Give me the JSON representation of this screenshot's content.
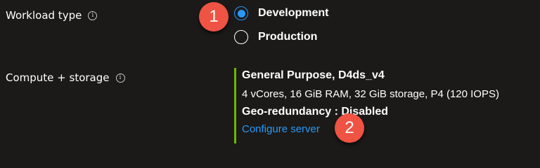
{
  "workload": {
    "label": "Workload type",
    "info_icon": "info-icon",
    "options": [
      {
        "label": "Development",
        "selected": true
      },
      {
        "label": "Production",
        "selected": false
      }
    ]
  },
  "compute": {
    "label": "Compute + storage",
    "info_icon": "info-icon",
    "summary_title": "General Purpose, D4ds_v4",
    "summary_specs": "4 vCores, 16 GiB RAM, 32 GiB storage, P4 (120 IOPS)",
    "geo_redundancy": "Geo-redundancy : Disabled",
    "configure_link": "Configure server"
  },
  "annotations": {
    "step1": "1",
    "step2": "2"
  },
  "colors": {
    "background": "#1b1a19",
    "accent_blue": "#2899f5",
    "summary_bar_green": "#6bb700",
    "annotation_red": "#ee5343"
  }
}
